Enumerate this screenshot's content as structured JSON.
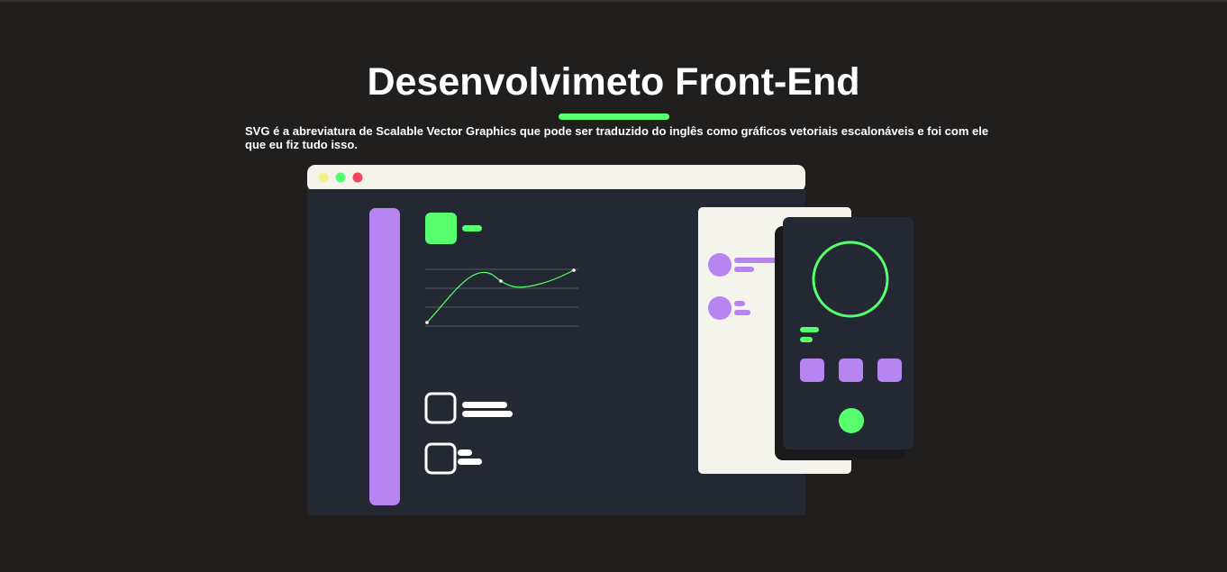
{
  "page": {
    "title": "Desenvolvimeto Front-End",
    "description": "SVG é a abreviatura de Scalable Vector Graphics que pode ser traduzido do inglês como gráficos vetoriais escalonáveis e foi com ele que eu fiz tudo isso."
  },
  "colors": {
    "background": "#211f1e",
    "accent_green": "#57ff6f",
    "accent_purple": "#b785f2",
    "panel_dark": "#232833",
    "panel_light": "#f5f4ec",
    "dot_yellow": "#f2f28c",
    "dot_green": "#57ff6f",
    "dot_red": "#f2445a"
  },
  "illustration": {
    "browser_window": {
      "title_bar_dots": [
        "yellow-dot",
        "green-dot",
        "red-dot"
      ]
    },
    "icons": [
      "line-chart-icon",
      "checkbox-icon",
      "avatar-icon",
      "circle-ring-icon",
      "mobile-phone-icon"
    ]
  }
}
